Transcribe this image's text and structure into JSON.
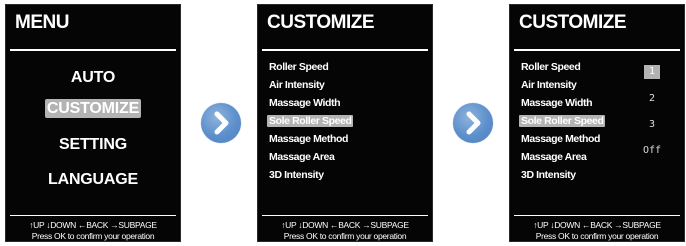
{
  "screens": {
    "menu": {
      "title": "MENU",
      "items": [
        {
          "label": "AUTO"
        },
        {
          "label": "CUSTOMIZE",
          "selected": true
        },
        {
          "label": "SETTING"
        },
        {
          "label": "LANGUAGE"
        }
      ],
      "footer": {
        "line1": "↑UP ↓DOWN ←BACK →SUBPAGE",
        "line2": "Press OK to confirm your operation"
      }
    },
    "customize": {
      "title": "CUSTOMIZE",
      "items": [
        {
          "label": "Roller Speed"
        },
        {
          "label": "Air Intensity"
        },
        {
          "label": "Massage Width"
        },
        {
          "label": "Sole Roller Speed",
          "selected": true
        },
        {
          "label": "Massage Method"
        },
        {
          "label": "Massage Area"
        },
        {
          "label": "3D Intensity"
        }
      ],
      "footer": {
        "line1": "↑UP ↓DOWN ←BACK →SUBPAGE",
        "line2": "Press OK to confirm your operation"
      }
    },
    "customize_sub": {
      "title": "CUSTOMIZE",
      "items": [
        {
          "label": "Roller Speed"
        },
        {
          "label": "Air Intensity"
        },
        {
          "label": "Massage Width"
        },
        {
          "label": "Sole Roller Speed",
          "selected": true
        },
        {
          "label": "Massage Method"
        },
        {
          "label": "Massage Area"
        },
        {
          "label": "3D Intensity"
        }
      ],
      "options": [
        {
          "label": "1",
          "selected": true
        },
        {
          "label": "2"
        },
        {
          "label": "3"
        },
        {
          "label": "Off"
        }
      ],
      "footer": {
        "line1": "↑UP ↓DOWN ←BACK →SUBPAGE",
        "line2": "Press OK to confirm your operation"
      }
    }
  },
  "icons": {
    "next": "chevron-right-icon"
  },
  "colors": {
    "screen_bg": "#050505",
    "highlight": "#b3b3b3",
    "arrow_blue": "#5c8fcb"
  }
}
